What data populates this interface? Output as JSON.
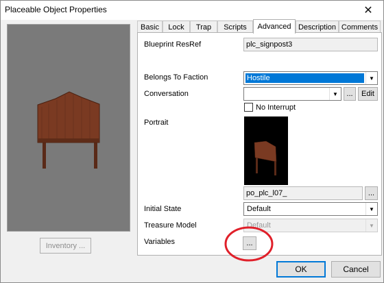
{
  "window": {
    "title": "Placeable Object Properties",
    "close_glyph": "✕"
  },
  "tabs": [
    {
      "label": "Basic"
    },
    {
      "label": "Lock"
    },
    {
      "label": "Trap"
    },
    {
      "label": "Scripts"
    },
    {
      "label": "Advanced"
    },
    {
      "label": "Description"
    },
    {
      "label": "Comments"
    }
  ],
  "active_tab": "Advanced",
  "advanced": {
    "blueprint_resref_label": "Blueprint ResRef",
    "blueprint_resref_value": "plc_signpost3",
    "faction_label": "Belongs To Faction",
    "faction_value": "Hostile",
    "conversation_label": "Conversation",
    "conversation_value": "",
    "browse_label": "...",
    "edit_label": "Edit",
    "no_interrupt_label": "No Interrupt",
    "no_interrupt_checked": false,
    "portrait_label": "Portrait",
    "portrait_value": "po_plc_l07_",
    "portrait_browse_label": "...",
    "initial_state_label": "Initial State",
    "initial_state_value": "Default",
    "treasure_model_label": "Treasure Model",
    "treasure_model_value": "Default",
    "variables_label": "Variables",
    "variables_button_label": "..."
  },
  "preview": {
    "inventory_label": "Inventory ..."
  },
  "footer": {
    "ok_label": "OK",
    "cancel_label": "Cancel"
  },
  "colors": {
    "selection": "#0078d7",
    "annotation": "#e0202a",
    "wood": "#7a3a22"
  }
}
